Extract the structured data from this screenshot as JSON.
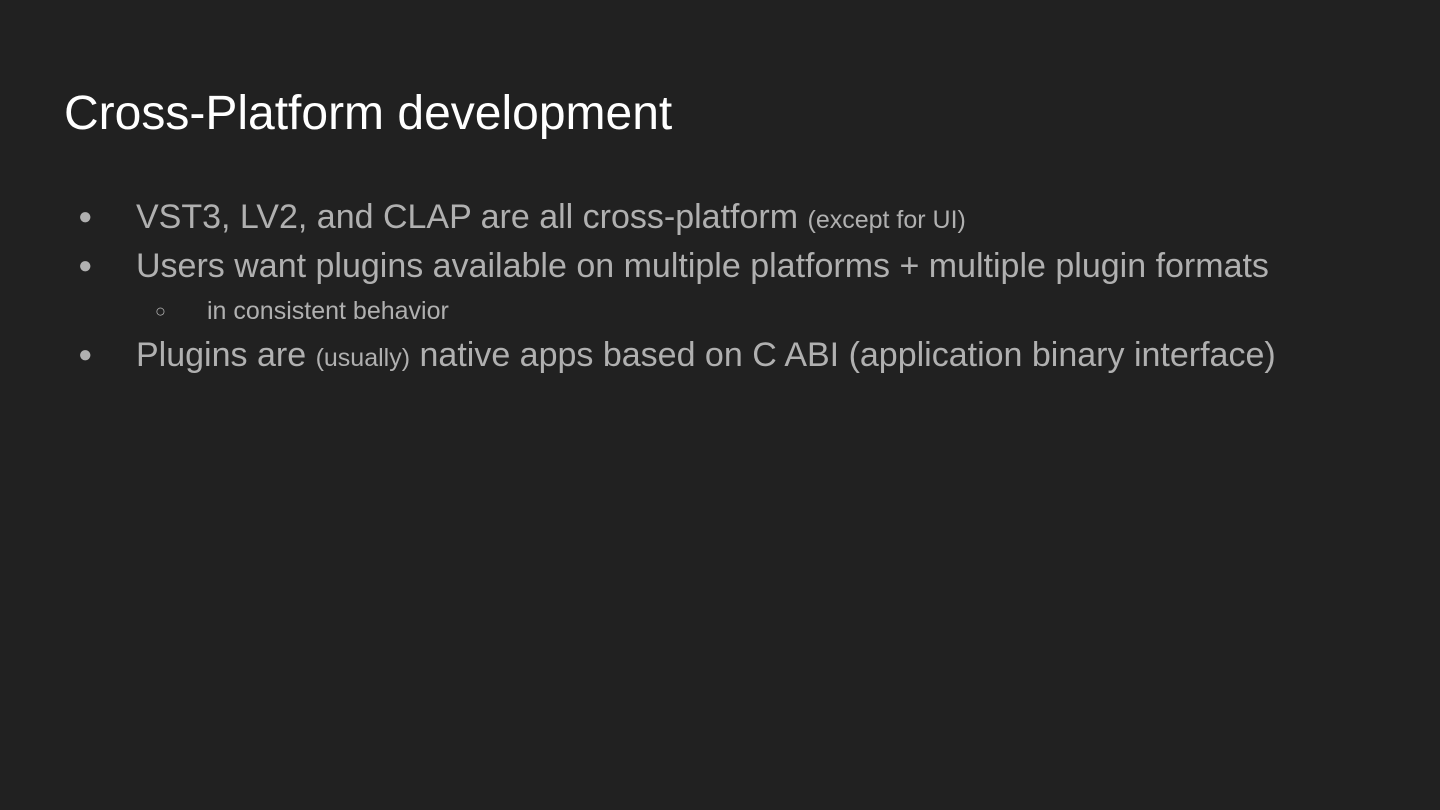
{
  "slide": {
    "title": "Cross-Platform development",
    "colors": {
      "background": "#212121",
      "title": "#ffffff",
      "body": "#b0b0b0"
    },
    "bullets": [
      {
        "marker_icon": "disc-bullet-icon",
        "text": "VST3, LV2, and CLAP are all cross-platform",
        "aside": "(except for UI)"
      },
      {
        "marker_icon": "disc-bullet-icon",
        "text": "Users want plugins available on multiple platforms + multiple plugin formats"
      },
      {
        "marker_icon": "circle-bullet-icon",
        "text": "in consistent behavior"
      },
      {
        "marker_icon": "disc-bullet-icon",
        "text_before": "Plugins are",
        "aside": "(usually)",
        "text_after": "native apps based on C ABI (application binary interface)"
      }
    ]
  }
}
